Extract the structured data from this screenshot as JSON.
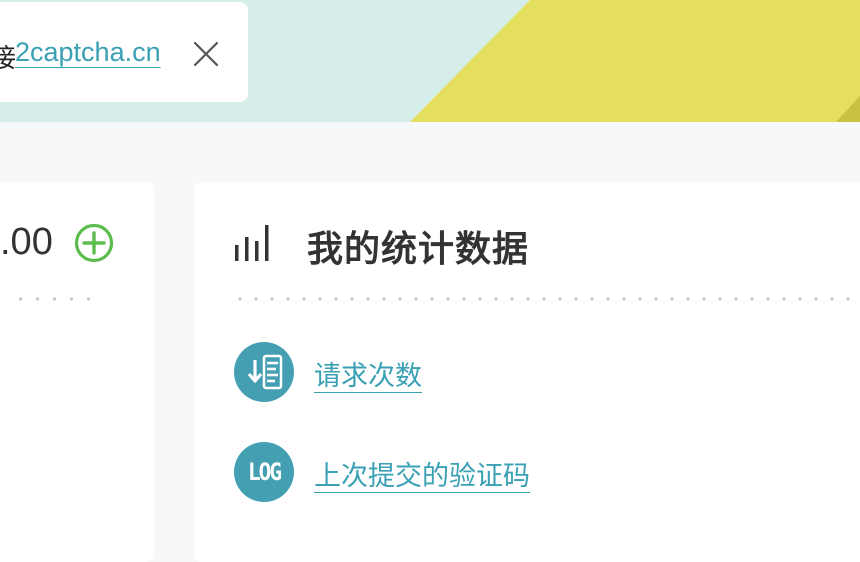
{
  "colors": {
    "banner_bg": "#d5eeea",
    "banner_accent": "#e4df5e",
    "link": "#3aa0b4",
    "icon_circle": "#449fb3",
    "add_icon": "#5cbd4e"
  },
  "notice": {
    "prefix": "接",
    "link_text": "2captcha.cn",
    "close_icon": "close-icon"
  },
  "balance": {
    "amount": ".00",
    "add_icon": "plus-circle-icon"
  },
  "stats": {
    "title": "我的统计数据",
    "title_icon": "bar-chart-icon",
    "links": [
      {
        "label": "请求次数",
        "icon": "sort-list-icon"
      },
      {
        "label": "上次提交的验证码",
        "icon": "log-icon",
        "icon_text": "LOG"
      }
    ]
  }
}
